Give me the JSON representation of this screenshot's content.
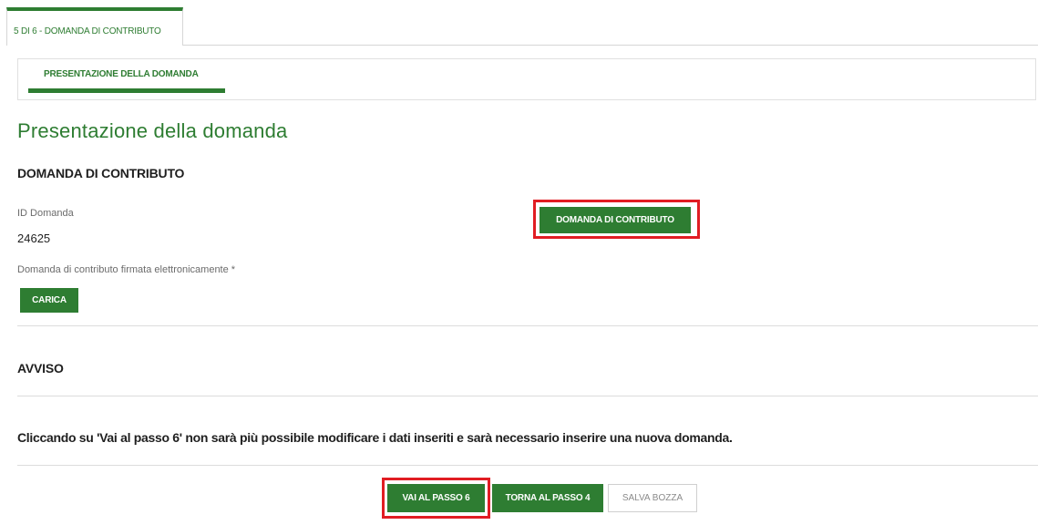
{
  "step_tab": {
    "label": "5 DI 6 - DOMANDA DI CONTRIBUTO"
  },
  "sub_tab": {
    "label": "PRESENTAZIONE DELLA DOMANDA"
  },
  "page": {
    "title": "Presentazione della domanda"
  },
  "sections": {
    "domanda": {
      "title": "DOMANDA DI CONTRIBUTO",
      "id_label": "ID Domanda",
      "id_value": "24625",
      "download_button": "DOMANDA DI CONTRIBUTO",
      "signed_label": "Domanda di contributo firmata elettronicamente *",
      "upload_button": "CARICA"
    },
    "avviso": {
      "title": "AVVISO",
      "message": "Cliccando su 'Vai al passo 6' non sarà più possibile modificare i dati inseriti e sarà necessario inserire una nuova domanda."
    }
  },
  "footer": {
    "next_button": "VAI AL PASSO 6",
    "back_button": "TORNA AL PASSO 4",
    "draft_button": "SALVA BOZZA"
  },
  "colors": {
    "accent": "#2e7d32",
    "highlight": "#e11d23",
    "text": "#1f1f1f",
    "muted": "#6b6b6b"
  }
}
